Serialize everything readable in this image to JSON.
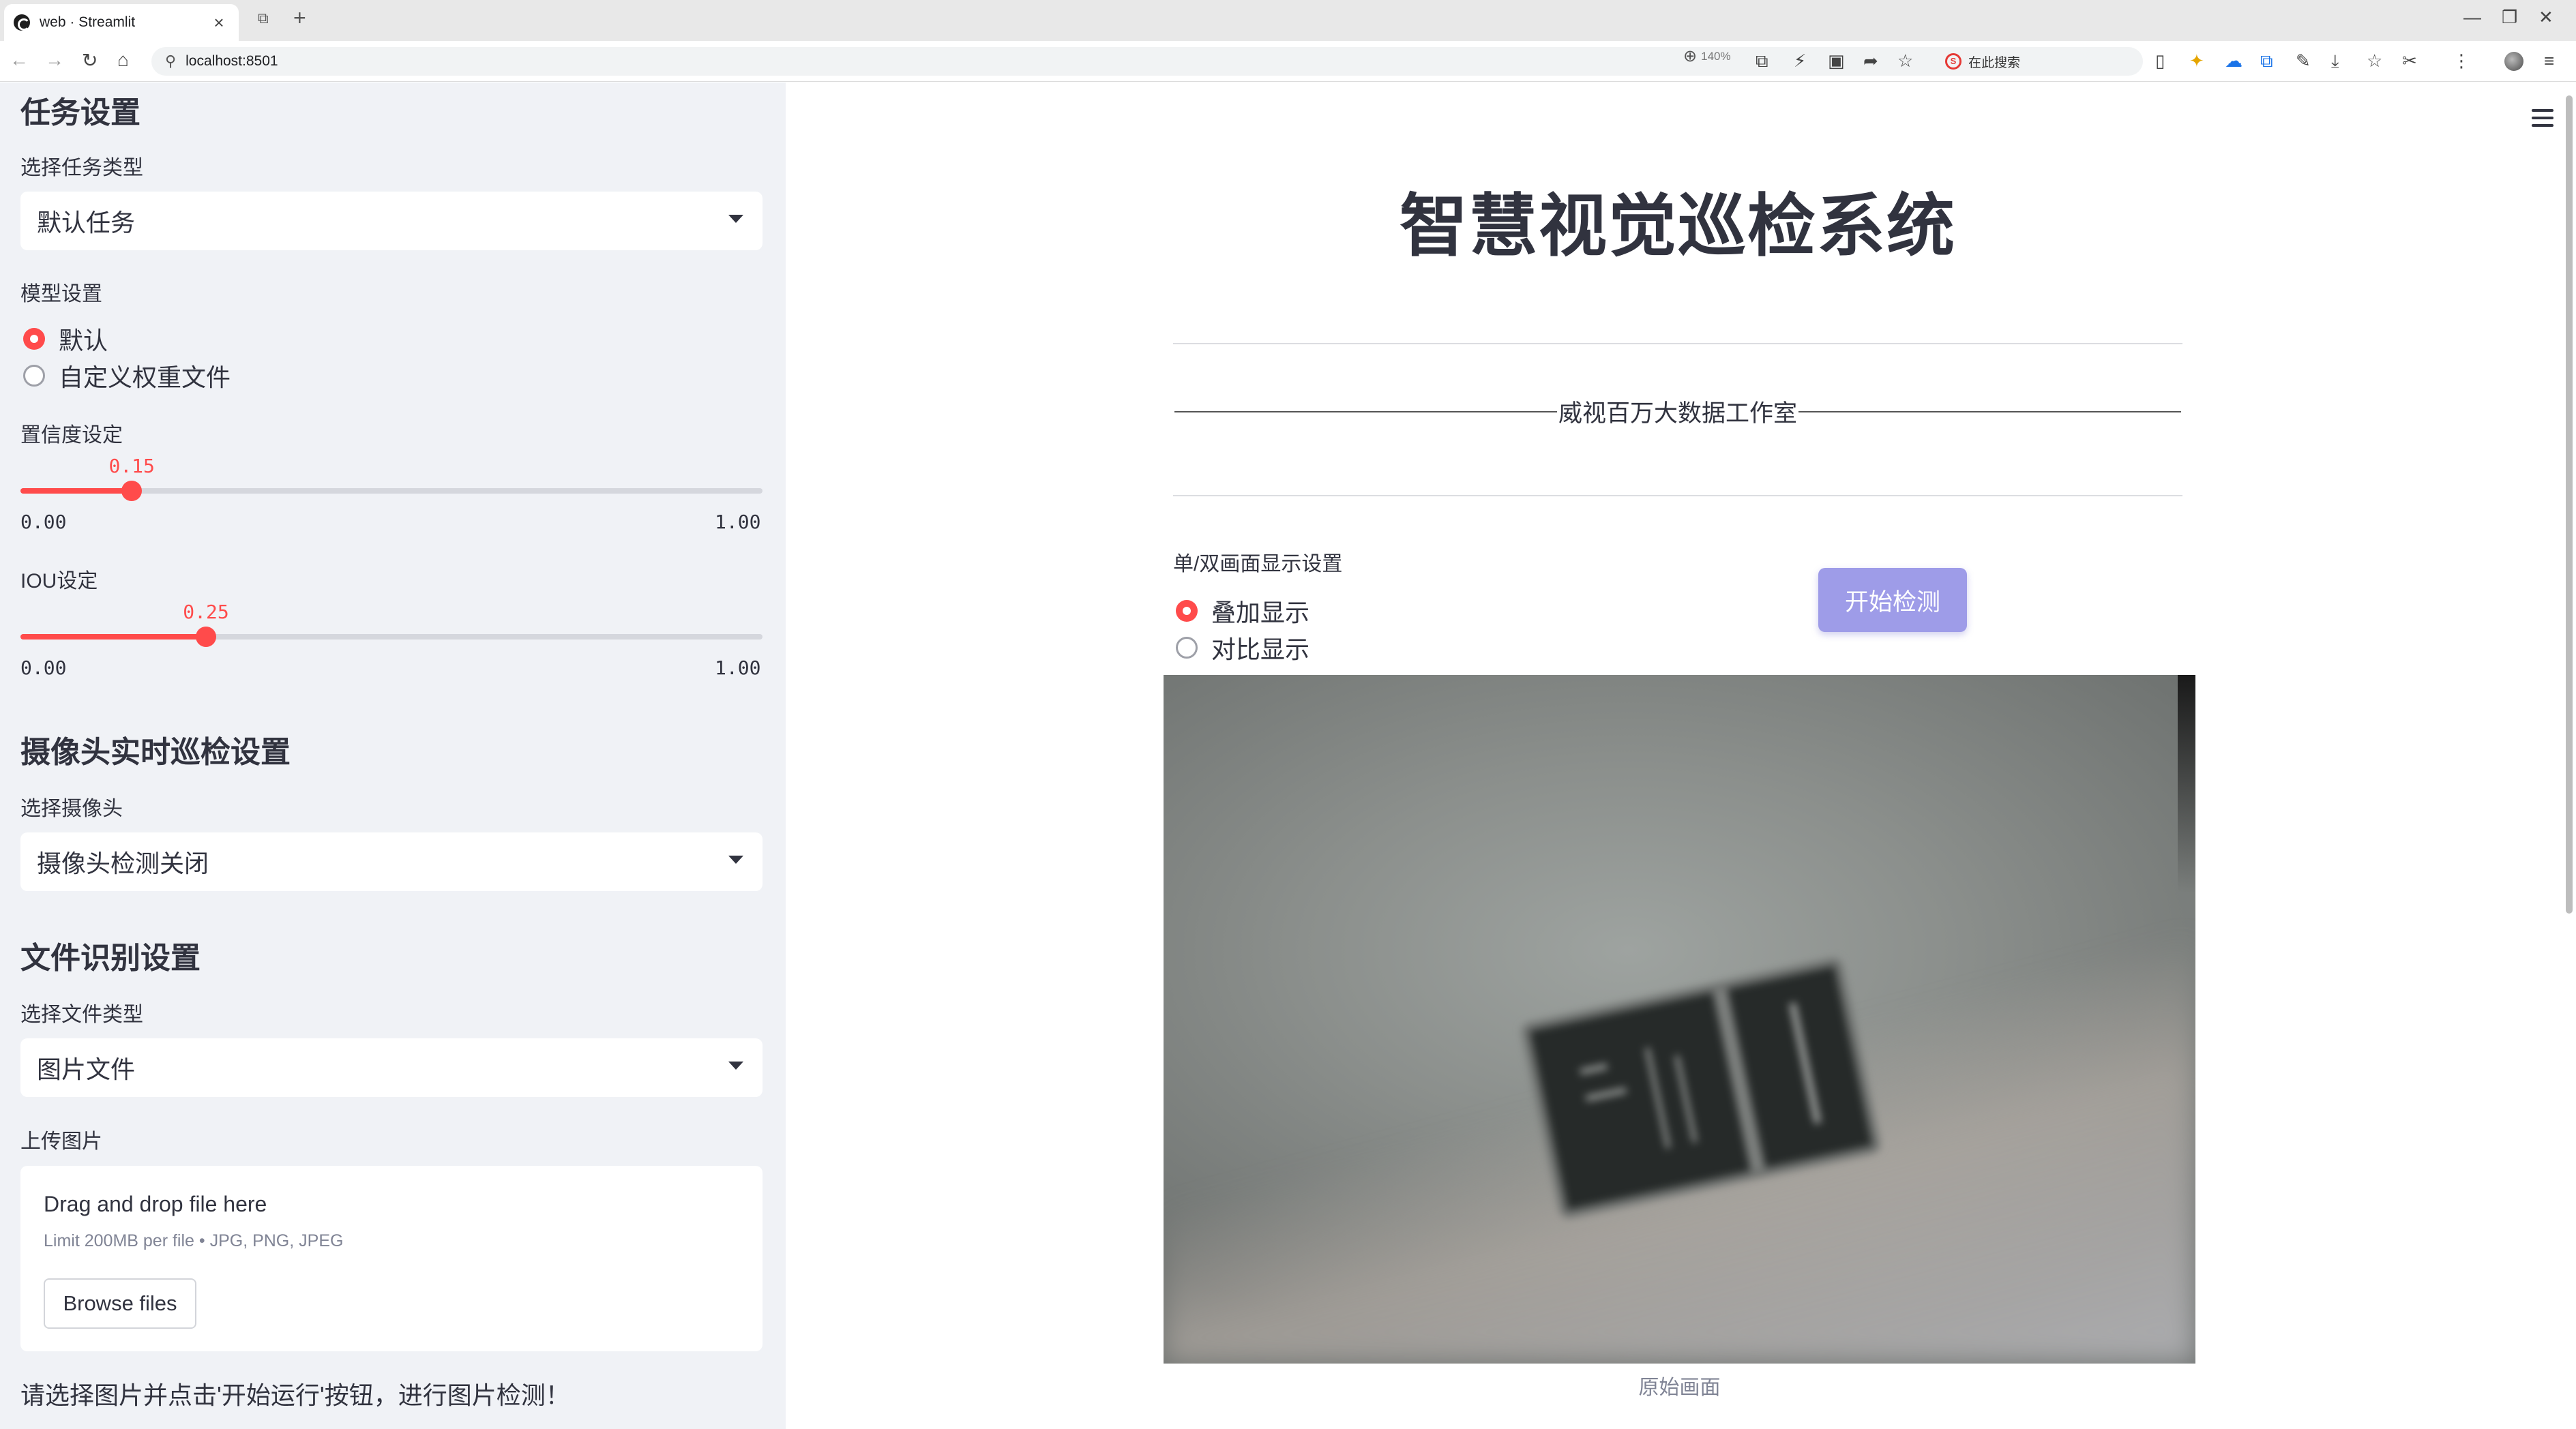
{
  "browser": {
    "tab_title": "web · Streamlit",
    "url": "localhost:8501",
    "zoom": "140%",
    "search_engine_label": "在此搜索"
  },
  "sidebar": {
    "task_section_title": "任务设置",
    "task_type_label": "选择任务类型",
    "task_type_value": "默认任务",
    "model_label": "模型设置",
    "model_options": [
      "默认",
      "自定义权重文件"
    ],
    "model_selected": "默认",
    "confidence": {
      "label": "置信度设定",
      "value": 0.15,
      "value_text": "0.15",
      "min_text": "0.00",
      "max_text": "1.00"
    },
    "iou": {
      "label": "IOU设定",
      "value": 0.25,
      "value_text": "0.25",
      "min_text": "0.00",
      "max_text": "1.00"
    },
    "camera_section_title": "摄像头实时巡检设置",
    "camera_label": "选择摄像头",
    "camera_value": "摄像头检测关闭",
    "file_section_title": "文件识别设置",
    "file_type_label": "选择文件类型",
    "file_type_value": "图片文件",
    "upload_label": "上传图片",
    "uploader": {
      "title": "Drag and drop file here",
      "limit": "Limit 200MB per file • JPG, PNG, JPEG",
      "button": "Browse files"
    },
    "note": "请选择图片并点击'开始运行'按钮，进行图片检测！"
  },
  "main": {
    "title": "智慧视觉巡检系统",
    "studio": "威视百万大数据工作室",
    "display_label": "单/双画面显示设置",
    "display_options": [
      "叠加显示",
      "对比显示"
    ],
    "display_selected": "叠加显示",
    "start_button": "开始检测",
    "image_caption": "原始画面"
  },
  "colors": {
    "accent": "#ff4b4b",
    "sidebar_bg": "#f0f2f6",
    "start_button": "#9e9ce8",
    "text": "#31333f"
  }
}
